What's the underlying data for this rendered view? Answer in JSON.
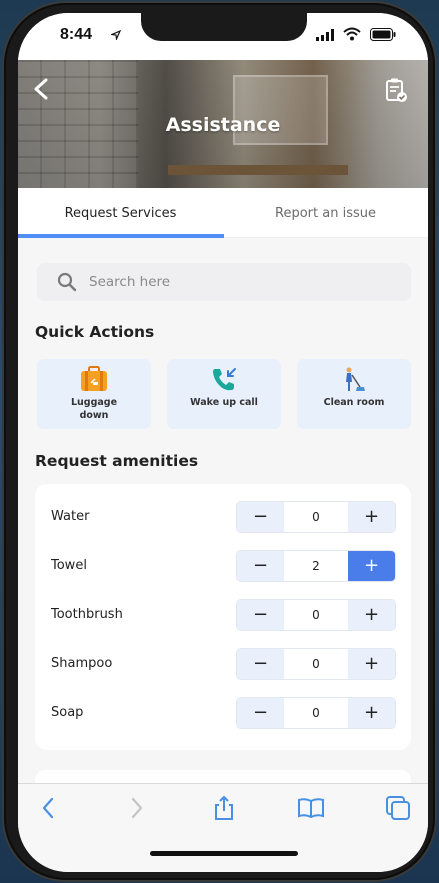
{
  "status_bar": {
    "time": "8:44"
  },
  "header": {
    "title": "Assistance"
  },
  "tabs": [
    {
      "label": "Request Services",
      "active": true
    },
    {
      "label": "Report an issue",
      "active": false
    }
  ],
  "search": {
    "placeholder": "Search here"
  },
  "quick_actions": {
    "title": "Quick Actions",
    "items": [
      {
        "label": "Luggage down",
        "icon": "luggage-icon"
      },
      {
        "label": "Wake up call",
        "icon": "phone-incoming-icon"
      },
      {
        "label": "Clean room",
        "icon": "cleaning-icon"
      }
    ]
  },
  "amenities": {
    "title": "Request amenities",
    "items": [
      {
        "label": "Water",
        "quantity": "0"
      },
      {
        "label": "Towel",
        "quantity": "2"
      },
      {
        "label": "Toothbrush",
        "quantity": "0"
      },
      {
        "label": "Shampoo",
        "quantity": "0"
      },
      {
        "label": "Soap",
        "quantity": "0"
      }
    ],
    "minus_symbol": "−",
    "plus_symbol": "+"
  },
  "colors": {
    "accent": "#4f8ef7",
    "active_plus": "#4a7dea",
    "card_bg": "#e8f0fc",
    "safari_icon": "#4a90e2"
  }
}
